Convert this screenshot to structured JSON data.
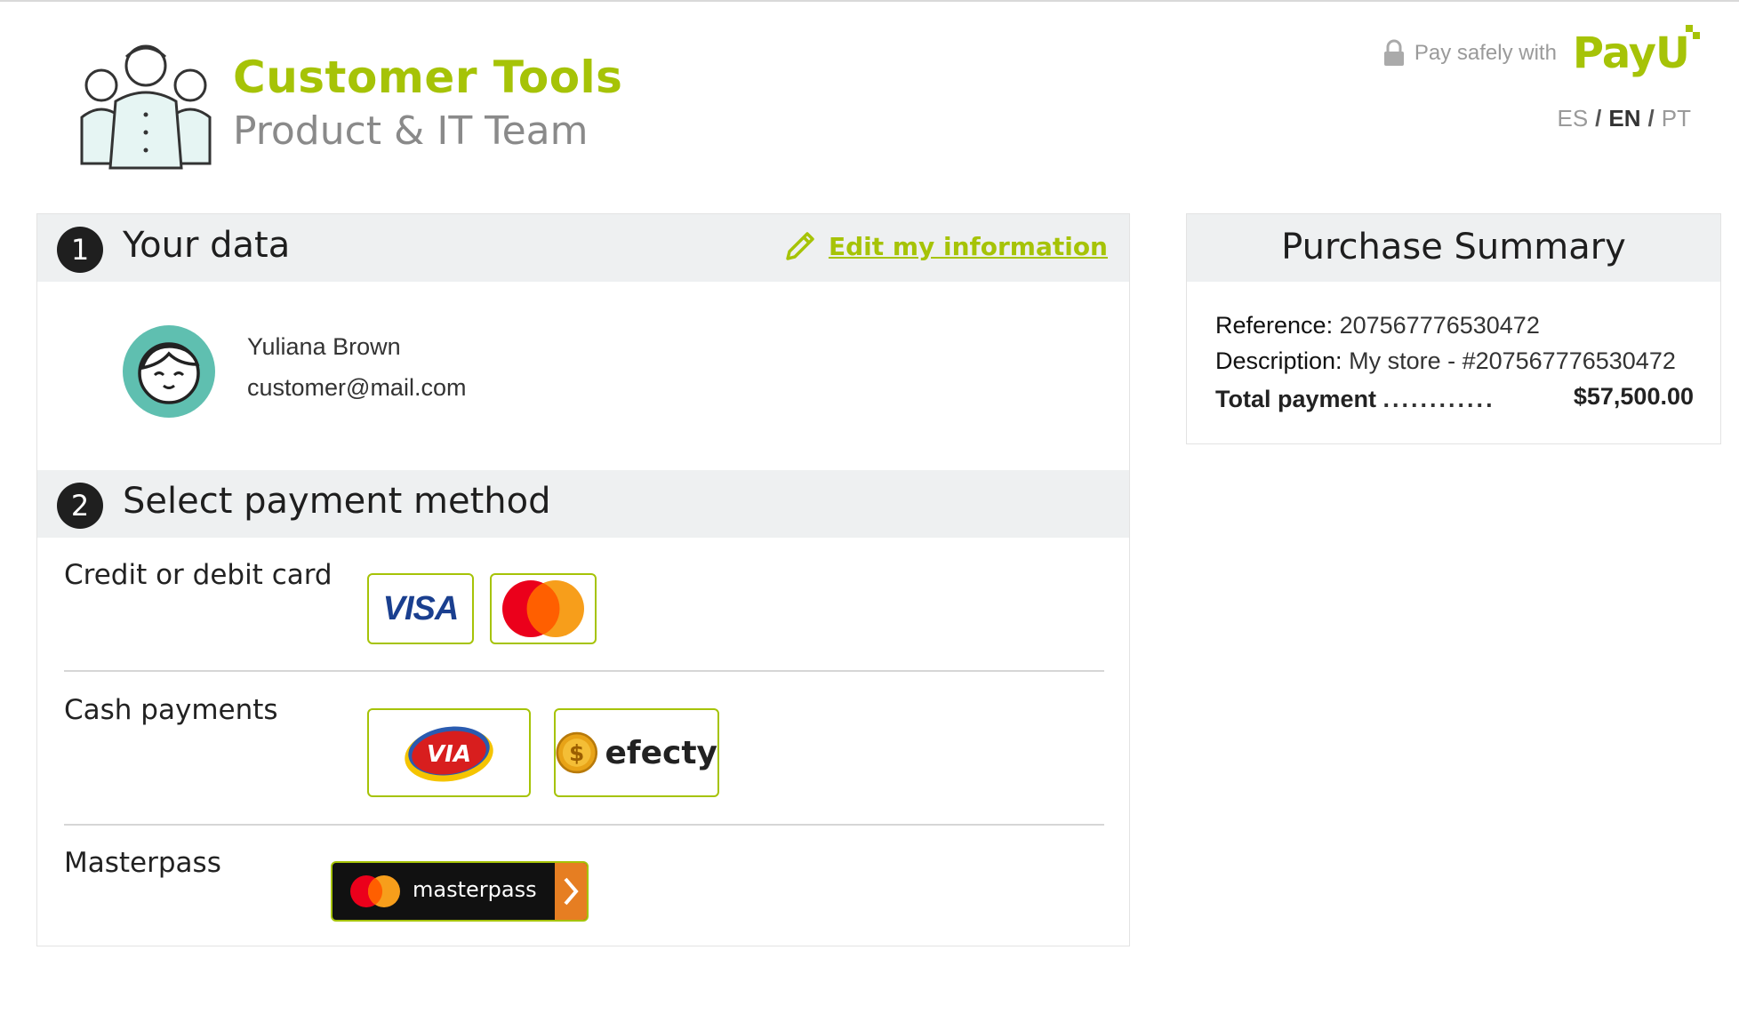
{
  "brand": {
    "title": "Customer Tools",
    "subtitle": "Product & IT Team"
  },
  "header": {
    "pay_safely": "Pay safely with",
    "payu_logo": "PayU",
    "languages": [
      "ES",
      "EN",
      "PT"
    ],
    "active_language": "EN",
    "separator": "/"
  },
  "your_data": {
    "number": "1",
    "title": "Your data",
    "edit_label": "Edit my information",
    "name": "Yuliana Brown",
    "email": "customer@mail.com"
  },
  "payment": {
    "number": "2",
    "title": "Select payment method",
    "credit_label": "Credit or debit card",
    "cash_label": "Cash payments",
    "masterpass_label": "Masterpass",
    "visa_text": "VISA",
    "via_text": "VIA",
    "efecty_text": "efecty",
    "masterpass_text": "masterpass"
  },
  "summary": {
    "title": "Purchase Summary",
    "reference_key": "Reference:",
    "reference_value": "207567776530472",
    "description_key": "Description:",
    "description_value": "My store - #207567776530472",
    "total_key": "Total payment",
    "total_dots": "............",
    "total_value": "$57,500.00"
  },
  "colors": {
    "accent": "#a6c307",
    "section_bg": "#eef0f1",
    "avatar": "#5fbfb0",
    "masterpass_arrow": "#e67e22"
  },
  "icons": [
    "family-logo-icon",
    "lock-icon",
    "pencil-icon",
    "user-face-icon",
    "mastercard-icon",
    "efecty-coin-icon",
    "chevron-right-icon"
  ]
}
